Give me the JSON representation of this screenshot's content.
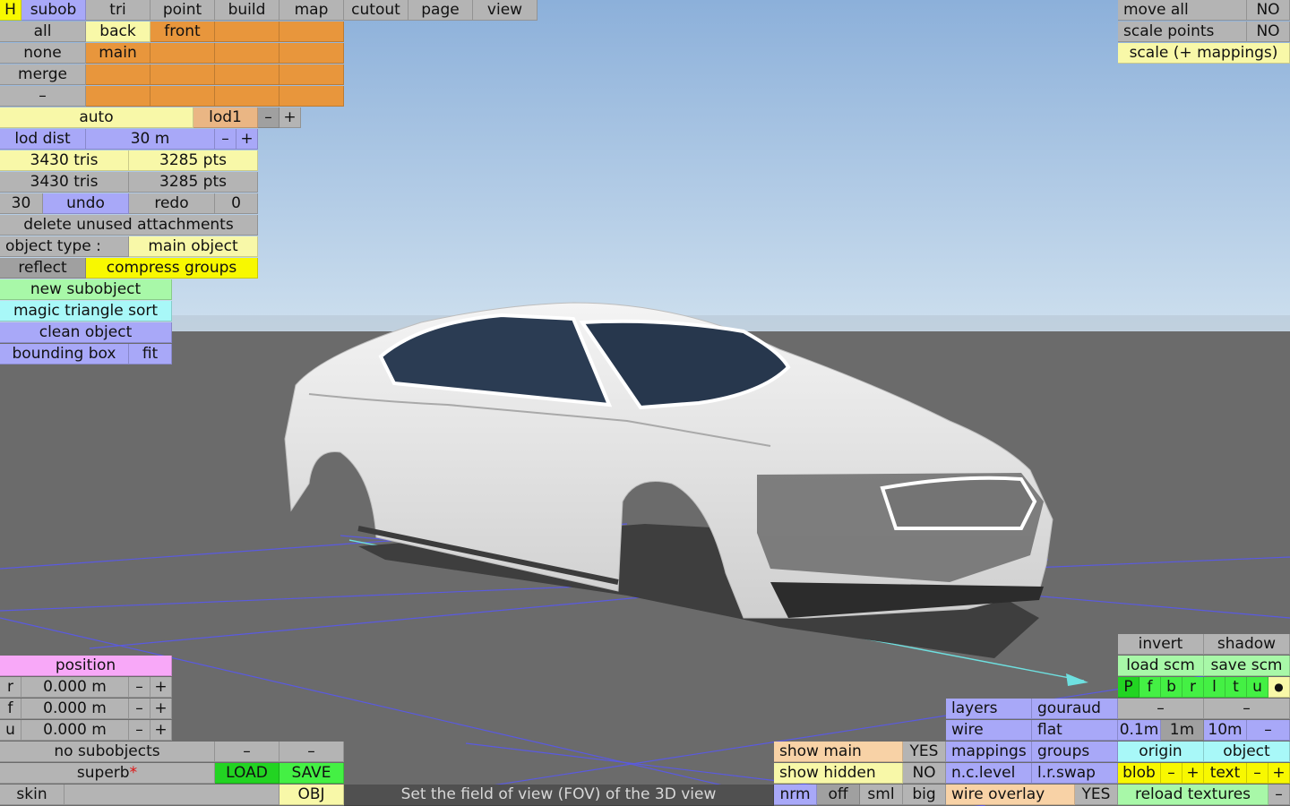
{
  "menu": {
    "h": "H",
    "subob": "subob",
    "tri": "tri",
    "point": "point",
    "build": "build",
    "map": "map",
    "cutout": "cutout",
    "page": "page",
    "view": "view"
  },
  "parts": {
    "all": "all",
    "back": "back",
    "front": "front",
    "none": "none",
    "main": "main",
    "merge": "merge",
    "dash": "–"
  },
  "lod": {
    "auto": "auto",
    "lod1": "lod1",
    "minus": "–",
    "plus": "+",
    "lod_dist": "lod dist",
    "dist_value": "30 m"
  },
  "stats": {
    "tris_a": "3430 tris",
    "pts_a": "3285 pts",
    "tris_b": "3430 tris",
    "pts_b": "3285 pts"
  },
  "history": {
    "undo_count": "30",
    "undo": "undo",
    "redo": "redo",
    "redo_count": "0"
  },
  "actions": {
    "delete_unused": "delete unused attachments",
    "object_type_label": "object type :",
    "object_type_value": "main object",
    "reflect": "reflect",
    "compress_groups": "compress groups",
    "new_subobject": "new subobject",
    "magic_sort": "magic triangle sort",
    "clean_object": "clean object",
    "bounding_box": "bounding box",
    "fit": "fit"
  },
  "topright": {
    "move_all": "move all",
    "move_all_val": "NO",
    "scale_points": "scale points",
    "scale_points_val": "NO",
    "scale_mappings": "scale (+ mappings)"
  },
  "position": {
    "title": "position",
    "rows": [
      {
        "axis": "r",
        "value": "0.000 m"
      },
      {
        "axis": "f",
        "value": "0.000 m"
      },
      {
        "axis": "u",
        "value": "0.000 m"
      }
    ],
    "minus": "–",
    "plus": "+"
  },
  "bottomleft": {
    "no_subobjects": "no subobjects",
    "dash": "–",
    "quality": "superb",
    "star": "*",
    "load": "LOAD",
    "save": "SAVE",
    "skin": "skin",
    "obj": "OBJ"
  },
  "status_text": "Set the field of view (FOV) of the 3D view",
  "show": {
    "show_main": "show main",
    "show_main_val": "YES",
    "show_hidden": "show hidden",
    "show_hidden_val": "NO",
    "nrm": "nrm",
    "off": "off",
    "sml": "sml",
    "big": "big"
  },
  "render": {
    "layers": "layers",
    "gouraud": "gouraud",
    "wire": "wire",
    "flat": "flat",
    "mappings": "mappings",
    "groups": "groups",
    "nc_level": "n.c.level",
    "lr_swap": "l.r.swap",
    "wire_overlay": "wire overlay",
    "wire_overlay_val": "YES"
  },
  "rightpanel": {
    "invert": "invert",
    "shadow": "shadow",
    "load_scm": "load scm",
    "save_scm": "save scm",
    "views": [
      "P",
      "f",
      "b",
      "r",
      "l",
      "t",
      "u"
    ],
    "dot": "●",
    "dash": "–",
    "grid": [
      "0.1m",
      "1m",
      "10m"
    ],
    "origin": "origin",
    "object": "object",
    "blob": "blob",
    "text": "text",
    "minus": "–",
    "plus": "+",
    "reload_textures": "reload textures"
  },
  "colors": {
    "sky_top": "#8fb3dc",
    "sky_bottom": "#c9dced",
    "ground": "#6b6b6b",
    "car_body": "#e9e9e9",
    "glass": "#2b3c53",
    "grid": "#5a5ae0"
  }
}
